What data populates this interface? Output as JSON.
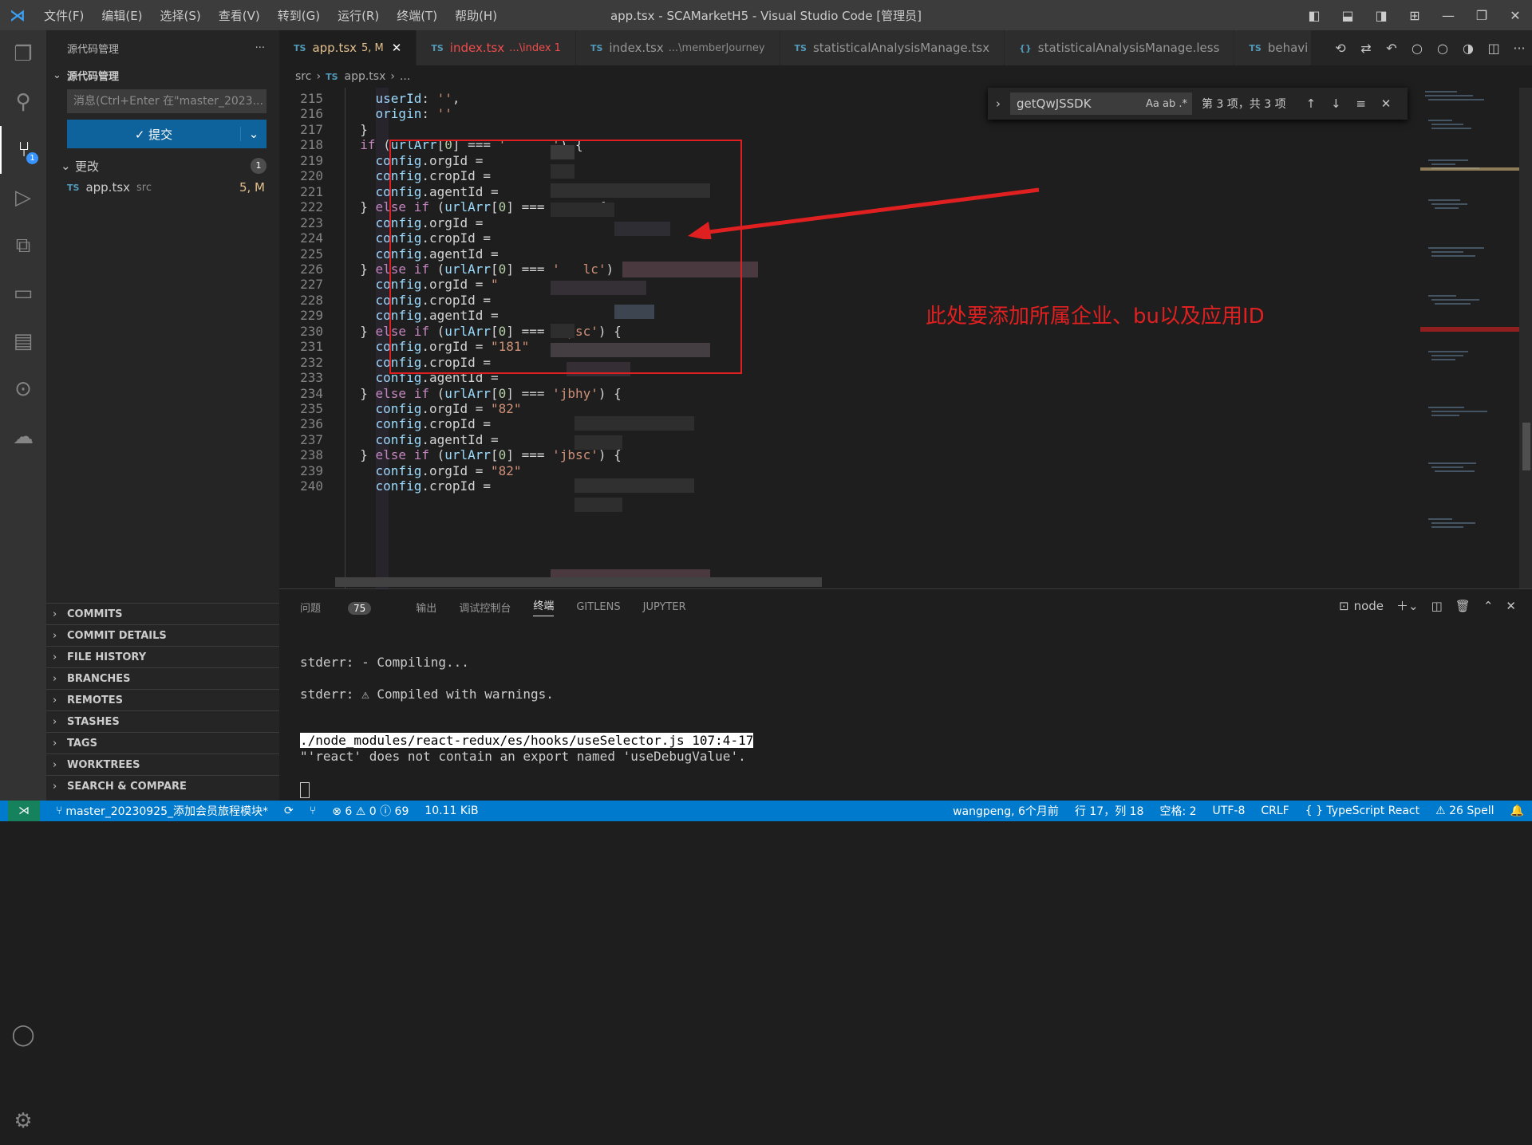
{
  "titlebar": {
    "menu": [
      "文件(F)",
      "编辑(E)",
      "选择(S)",
      "查看(V)",
      "转到(G)",
      "运行(R)",
      "终端(T)",
      "帮助(H)"
    ],
    "title": "app.tsx - SCAMarketH5 - Visual Studio Code [管理员]"
  },
  "sidebar": {
    "header": "源代码管理",
    "section": "源代码管理",
    "commit_placeholder": "消息(Ctrl+Enter 在\"master_2023...",
    "commit_button": "✓ 提交",
    "changes_label": "更改",
    "changes_count": "1",
    "file": {
      "name": "app.tsx",
      "path": "src",
      "status": "5, M"
    },
    "panels": [
      "COMMITS",
      "COMMIT DETAILS",
      "FILE HISTORY",
      "BRANCHES",
      "REMOTES",
      "STASHES",
      "TAGS",
      "WORKTREES",
      "SEARCH & COMPARE"
    ]
  },
  "tabs": [
    {
      "label": "app.tsx",
      "suffix": "5, M",
      "active": true
    },
    {
      "label": "index.tsx",
      "suffix": "...\\index 1"
    },
    {
      "label": "index.tsx",
      "suffix": "...\\memberJourney"
    },
    {
      "label": "statisticalAnalysisManage.tsx",
      "suffix": ""
    },
    {
      "label": "statisticalAnalysisManage.less",
      "suffix": ""
    },
    {
      "label": "behavi",
      "suffix": ""
    }
  ],
  "breadcrumb": {
    "folder": "src",
    "file": "app.tsx",
    "more": "..."
  },
  "find": {
    "query": "getQwJSSDK",
    "result": "第 3 项，共 3 项"
  },
  "code_lines": [
    {
      "n": "215",
      "t": "    userId: '',"
    },
    {
      "n": "216",
      "t": "    origin: ''"
    },
    {
      "n": "217",
      "t": "  }"
    },
    {
      "n": "218",
      "t": "  if (urlArr[0] === '      ') {"
    },
    {
      "n": "219",
      "t": "    config.orgId ="
    },
    {
      "n": "220",
      "t": "    config.cropId ="
    },
    {
      "n": "221",
      "t": "    config.agentId ="
    },
    {
      "n": "222",
      "t": "  } else if (urlArr[0] ===       {"
    },
    {
      "n": "223",
      "t": "    config.orgId ="
    },
    {
      "n": "224",
      "t": "    config.cropId ="
    },
    {
      "n": "225",
      "t": "    config.agentId ="
    },
    {
      "n": "226",
      "t": "  } else if (urlArr[0] === '   lc') {"
    },
    {
      "n": "227",
      "t": "    config.orgId = \""
    },
    {
      "n": "228",
      "t": "    config.cropId ="
    },
    {
      "n": "229",
      "t": "    config.agentId ="
    },
    {
      "n": "230",
      "t": "  } else if (urlArr[0] === 'hpsc') {"
    },
    {
      "n": "231",
      "t": "    config.orgId = \"181\""
    },
    {
      "n": "232",
      "t": "    config.cropId ="
    },
    {
      "n": "233",
      "t": "    config.agentId ="
    },
    {
      "n": "234",
      "t": "  } else if (urlArr[0] === 'jbhy') {"
    },
    {
      "n": "235",
      "t": "    config.orgId = \"82\""
    },
    {
      "n": "236",
      "t": "    config.cropId ="
    },
    {
      "n": "237",
      "t": "    config.agentId ="
    },
    {
      "n": "238",
      "t": "  } else if (urlArr[0] === 'jbsc') {"
    },
    {
      "n": "239",
      "t": "    config.orgId = \"82\""
    },
    {
      "n": "240",
      "t": "    config.cropId ="
    }
  ],
  "annotation": "此处要添加所属企业、bu以及应用ID",
  "panel": {
    "tabs": [
      "问题",
      "输出",
      "调试控制台",
      "终端",
      "GITLENS",
      "JUPYTER"
    ],
    "problems_count": "75",
    "terminal_name": "node",
    "lines": [
      "stderr: - Compiling...",
      "stderr: ⚠ Compiled with warnings.",
      "./node_modules/react-redux/es/hooks/useSelector.js 107:4-17",
      "\"'react' does not contain an export named 'useDebugValue'."
    ]
  },
  "statusbar": {
    "branch": "master_20230925_添加会员旅程模块*",
    "errors": "⊗ 6 ⚠ 0 ⓘ 69",
    "size": "10.11 KiB",
    "blame": "wangpeng, 6个月前",
    "position": "行 17，列 18",
    "spaces": "空格: 2",
    "encoding": "UTF-8",
    "eol": "CRLF",
    "language": "{ } TypeScript React",
    "spell": "⚠ 26 Spell"
  },
  "colors": {
    "accent": "#007acc",
    "annotation": "#e02020",
    "activity_bg": "#333333",
    "sidebar_bg": "#252526",
    "editor_bg": "#1e1e1e"
  }
}
